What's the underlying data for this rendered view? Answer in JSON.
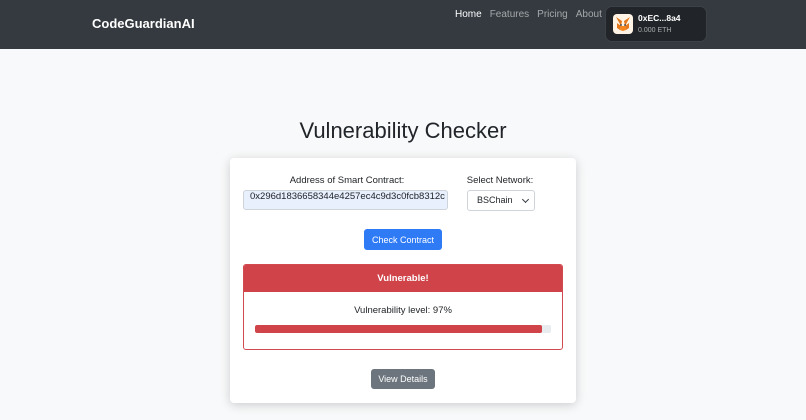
{
  "navbar": {
    "brand": "CodeGuardianAI",
    "links": [
      "Home",
      "Features",
      "Pricing",
      "About"
    ],
    "active_link": "Home",
    "wallet": {
      "icon": "metamask-fox-icon",
      "address": "0xEC...8a4",
      "balance": "0.000 ETH"
    }
  },
  "page": {
    "title": "Vulnerability Checker"
  },
  "form": {
    "address_label": "Address of Smart Contract:",
    "address_value": "0x296d1836658344e4257ec4c9d3c0fcb8312c",
    "network_label": "Select Network:",
    "network_value": "BSChain",
    "check_button": "Check Contract"
  },
  "result": {
    "status": "Vulnerable!",
    "level_text": "Vulnerability level: 97%",
    "level_value": 97,
    "status_color": "#cf4349"
  },
  "actions": {
    "view_details": "View Details"
  },
  "colors": {
    "navbar": "#343a40",
    "primary": "#2f7bf6",
    "danger": "#cf4349",
    "secondary": "#6c757d"
  }
}
